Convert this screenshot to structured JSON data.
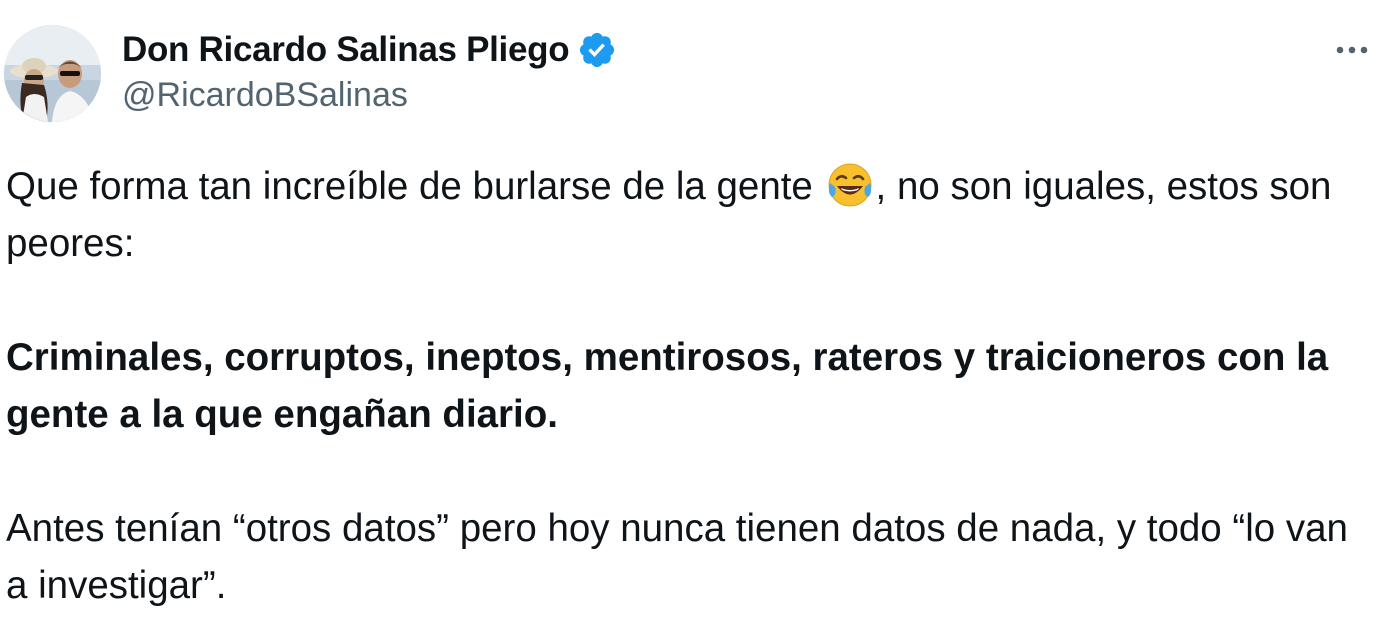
{
  "author": {
    "display_name": "Don Ricardo Salinas Pliego",
    "handle": "@RicardoBSalinas",
    "verified": true,
    "verified_color": "#1d9bf0",
    "avatar_icon": "profile-photo-avatar"
  },
  "menu": {
    "more_icon": "more-horizontal-icon",
    "more_glyph": "···"
  },
  "tweet": {
    "p1_before": "Que forma tan increíble de burlarse de la gente ",
    "emoji": "face-with-tears-of-joy",
    "p1_after": ", no son iguales, estos son peores:",
    "p2_bold": "Criminales, corruptos, ineptos, mentirosos, rateros y traicioneros con la gente a la que engañan diario.",
    "p3": "Antes tenían “otros datos” pero hoy nunca tienen datos de nada, y todo “lo van a investigar”."
  },
  "colors": {
    "text": "#0f1419",
    "secondary": "#536471",
    "background": "#ffffff"
  }
}
